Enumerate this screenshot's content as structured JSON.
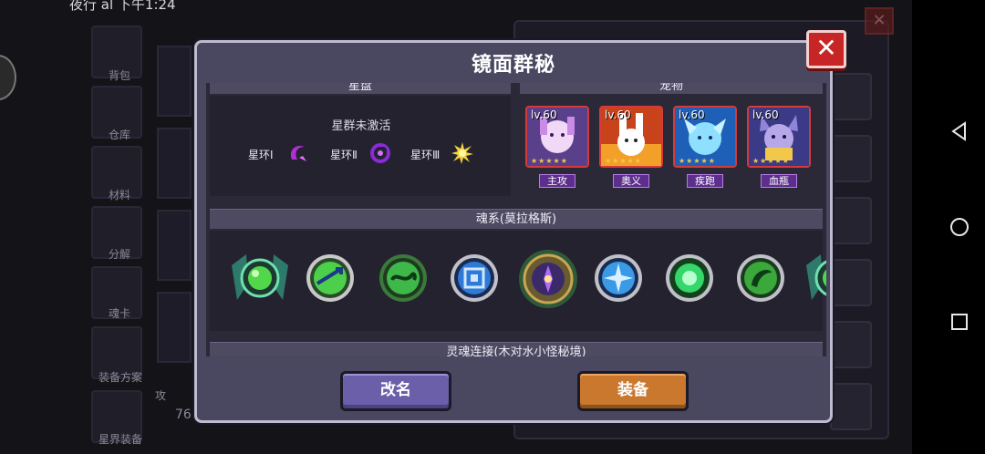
{
  "statusbar": {
    "left_text": "夜行 al 下午1:24"
  },
  "background": {
    "side_menu": [
      {
        "label": "背包"
      },
      {
        "label": "仓库"
      },
      {
        "label": "材料"
      },
      {
        "label": "分解"
      },
      {
        "label": "魂卡"
      },
      {
        "label": "装备方案"
      },
      {
        "label": "星界装备"
      }
    ],
    "attack_label": "攻",
    "attack_value": "76"
  },
  "dialog": {
    "title": "镜面群秘",
    "close_label": "✕",
    "star_section": {
      "header": "星盘",
      "status": "星群未激活",
      "rings": [
        {
          "label": "星环Ⅰ",
          "icon": "purple-crescent-icon"
        },
        {
          "label": "星环Ⅱ",
          "icon": "purple-swirl-icon"
        },
        {
          "label": "星环Ⅲ",
          "icon": "gold-sun-icon"
        }
      ]
    },
    "pet_section": {
      "header": "宠物",
      "pets": [
        {
          "level": "lv.60",
          "stars": "★★★★★",
          "tag": "主攻",
          "art": "pink-white-bunny-girl"
        },
        {
          "level": "lv.60",
          "stars": "★★★★★",
          "tag": "奥义",
          "art": "white-rabbit-fire"
        },
        {
          "level": "lv.60",
          "stars": "★★★★★",
          "tag": "疾跑",
          "art": "blue-ice-spirit"
        },
        {
          "level": "lv.60",
          "stars": "★★★★★",
          "tag": "血瓶",
          "art": "purple-wolf-girl"
        }
      ]
    },
    "soul_section": {
      "header": "魂系(莫拉格斯)",
      "souls": [
        {
          "icon": "green-winged-orb-icon"
        },
        {
          "icon": "green-arrow-rune-icon"
        },
        {
          "icon": "green-serpent-rune-icon"
        },
        {
          "icon": "blue-spiral-rune-icon"
        },
        {
          "icon": "violet-crest-emblem-icon"
        },
        {
          "icon": "blue-pinwheel-rune-icon"
        },
        {
          "icon": "green-glow-orb-icon"
        },
        {
          "icon": "green-leaf-rune-icon"
        },
        {
          "icon": "green-winged-orb-partial-icon"
        }
      ]
    },
    "bottom_section": {
      "header": "灵魂连接(木对水小怪秘境)"
    },
    "buttons": {
      "rename": "改名",
      "equip": "装备"
    }
  },
  "colors": {
    "dialog_bg": "#4a4760",
    "pet_border": "#d63a3a",
    "tag_bg": "#5d2f8c",
    "rename_btn": "#6a5fa8",
    "equip_btn": "#c9782e",
    "close_btn": "#c82626"
  }
}
